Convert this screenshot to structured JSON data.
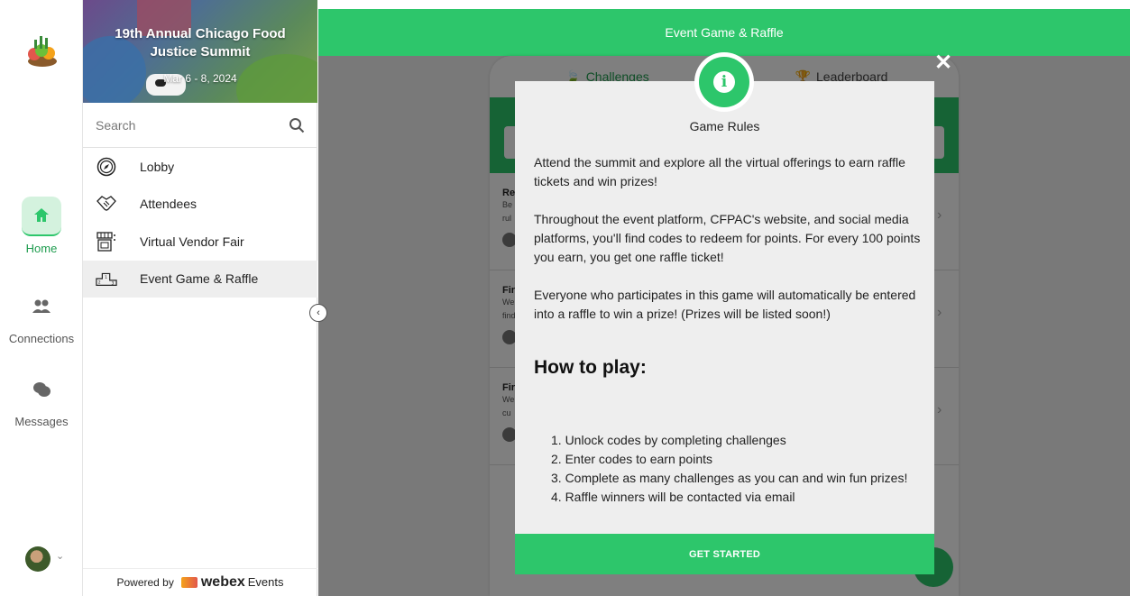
{
  "colors": {
    "brand_green": "#2dc66b",
    "overlay": "rgba(0,0,0,0.5)"
  },
  "rail": {
    "items": [
      {
        "label": "Home",
        "icon": "home-icon",
        "active": true
      },
      {
        "label": "Connections",
        "icon": "people-icon"
      },
      {
        "label": "Messages",
        "icon": "chat-icon"
      }
    ]
  },
  "sidebar": {
    "banner": {
      "title": "19th Annual Chicago Food Justice Summit",
      "date": "Mar 6 - 8, 2024"
    },
    "search": {
      "placeholder": "Search"
    },
    "nav": [
      {
        "label": "Lobby",
        "icon": "compass-icon"
      },
      {
        "label": "Attendees",
        "icon": "handshake-icon"
      },
      {
        "label": "Virtual Vendor Fair",
        "icon": "storefront-icon"
      },
      {
        "label": "Event Game & Raffle",
        "icon": "podium-icon",
        "active": true
      }
    ],
    "powered": {
      "prefix": "Powered by",
      "brand": "webex",
      "suffix": "Events"
    }
  },
  "header": {
    "title": "Event Game & Raffle"
  },
  "panel": {
    "tabs": [
      {
        "label": "Challenges",
        "active": true
      },
      {
        "label": "Leaderboard"
      }
    ],
    "rows": [
      {
        "title": "Re",
        "desc1": "Be",
        "desc2": "rul"
      },
      {
        "title": "Fir",
        "desc1": "We",
        "desc2": "find"
      },
      {
        "title": "Fir",
        "desc1": "We",
        "desc2": "cu"
      }
    ]
  },
  "modal": {
    "title": "Game Rules",
    "paragraphs": [
      "Attend the summit and explore all the virtual offerings to earn raffle tickets and win prizes!",
      "Throughout the event platform, CFPAC's website, and social media platforms, you'll find codes to redeem for points. For every 100 points you earn, you get one raffle ticket!",
      "Everyone who participates in this game will automatically be entered into a raffle to win a prize! (Prizes will be listed soon!)"
    ],
    "how_to_heading": "How to play:",
    "steps": [
      "1. Unlock codes by completing challenges",
      "2. Enter codes to earn points",
      "3. Complete as many challenges as you can and win fun prizes!",
      "4. Raffle winners will be contacted via email"
    ],
    "button_label": "GET STARTED",
    "close_label": "✕"
  }
}
